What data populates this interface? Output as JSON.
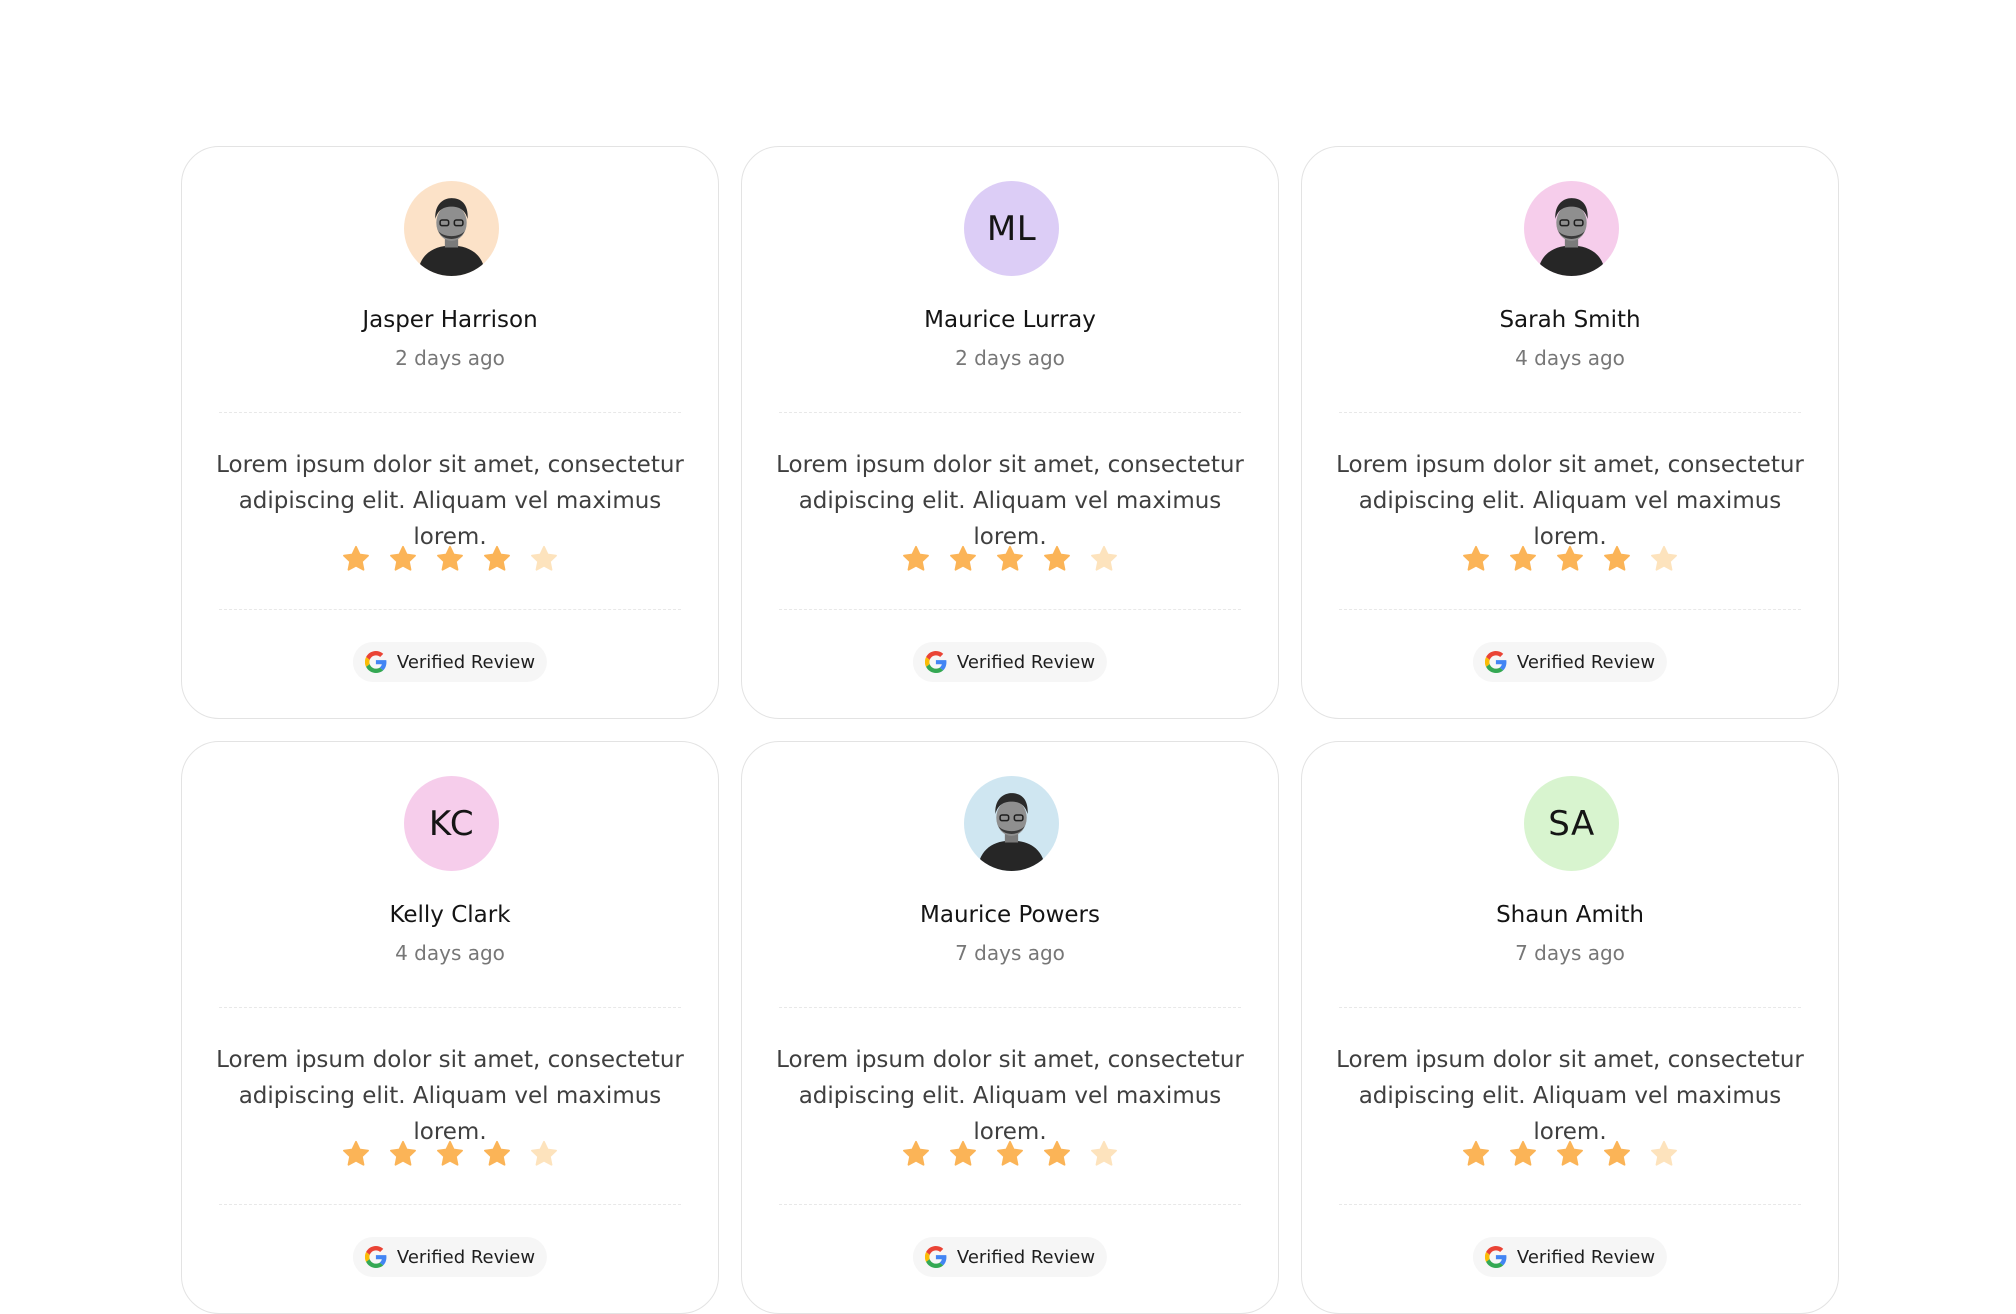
{
  "colors": {
    "star_full": "#FBB457",
    "star_empty": "#FDE3BD",
    "card_border": "#E3E3E3"
  },
  "reviews": [
    {
      "name": "Jasper Harrison",
      "time": "2 days ago",
      "text": "Lorem ipsum dolor sit amet, consectetur adipiscing elit. Aliquam vel maximus lorem.",
      "rating": 4,
      "max_rating": 5,
      "badge": "Verified Review",
      "avatar": {
        "type": "photo",
        "bg": "#FCE2C8",
        "icon": "person-photo-icon"
      }
    },
    {
      "name": "Maurice Lurray",
      "time": "2 days ago",
      "text": "Lorem ipsum dolor sit amet, consectetur adipiscing elit. Aliquam vel maximus lorem.",
      "rating": 4,
      "max_rating": 5,
      "badge": "Verified Review",
      "avatar": {
        "type": "initials",
        "initials": "ML",
        "bg": "#DCCDF6"
      }
    },
    {
      "name": "Sarah Smith",
      "time": "4 days ago",
      "text": "Lorem ipsum dolor sit amet, consectetur adipiscing elit. Aliquam vel maximus lorem.",
      "rating": 4,
      "max_rating": 5,
      "badge": "Verified Review",
      "avatar": {
        "type": "photo",
        "bg": "#F6CDEB",
        "icon": "person-photo-icon"
      }
    },
    {
      "name": "Kelly Clark",
      "time": "4 days ago",
      "text": "Lorem ipsum dolor sit amet, consectetur adipiscing elit. Aliquam vel maximus lorem.",
      "rating": 4,
      "max_rating": 5,
      "badge": "Verified Review",
      "avatar": {
        "type": "initials",
        "initials": "KC",
        "bg": "#F6CDEB"
      }
    },
    {
      "name": "Maurice Powers",
      "time": "7 days ago",
      "text": "Lorem ipsum dolor sit amet, consectetur adipiscing elit. Aliquam vel maximus lorem.",
      "rating": 4,
      "max_rating": 5,
      "badge": "Verified Review",
      "avatar": {
        "type": "photo",
        "bg": "#CFE6F1",
        "icon": "person-photo-icon"
      }
    },
    {
      "name": "Shaun Amith",
      "time": "7 days ago",
      "text": "Lorem ipsum dolor sit amet, consectetur adipiscing elit. Aliquam vel maximus lorem.",
      "rating": 4,
      "max_rating": 5,
      "badge": "Verified Review",
      "avatar": {
        "type": "initials",
        "initials": "SA",
        "bg": "#D8F4CF"
      }
    }
  ]
}
